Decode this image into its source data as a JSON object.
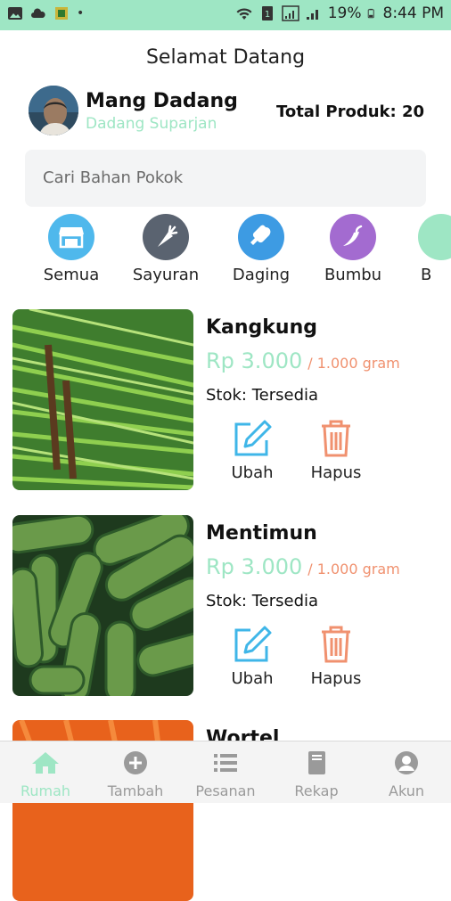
{
  "status_bar": {
    "battery": "19%",
    "time": "8:44 PM"
  },
  "header": {
    "title": "Selamat Datang"
  },
  "user": {
    "name": "Mang Dadang",
    "full_name": "Dadang Suparjan"
  },
  "total_products": "Total Produk: 20",
  "search": {
    "placeholder": "Cari Bahan Pokok"
  },
  "categories": [
    {
      "label": "Semua",
      "icon": "shop-icon",
      "color": "#4fb8ec"
    },
    {
      "label": "Sayuran",
      "icon": "carrot-icon",
      "color": "#5a6370"
    },
    {
      "label": "Daging",
      "icon": "meat-icon",
      "color": "#3d9be3"
    },
    {
      "label": "Bumbu",
      "icon": "chili-icon",
      "color": "#a36bd0"
    },
    {
      "label": "B",
      "icon": "category-icon",
      "color": "#9ee6c4"
    }
  ],
  "products": [
    {
      "name": "Kangkung",
      "price": "Rp 3.000",
      "unit": "/ 1.000 gram",
      "stock": "Stok: Tersedia",
      "edit_label": "Ubah",
      "delete_label": "Hapus"
    },
    {
      "name": "Mentimun",
      "price": "Rp 3.000",
      "unit": "/ 1.000 gram",
      "stock": "Stok: Tersedia",
      "edit_label": "Ubah",
      "delete_label": "Hapus"
    },
    {
      "name": "Wortel"
    }
  ],
  "bottom_nav": [
    {
      "label": "Rumah",
      "icon": "home-icon",
      "active": true
    },
    {
      "label": "Tambah",
      "icon": "add-circle-icon"
    },
    {
      "label": "Pesanan",
      "icon": "list-icon"
    },
    {
      "label": "Rekap",
      "icon": "book-icon"
    },
    {
      "label": "Akun",
      "icon": "account-icon"
    }
  ],
  "colors": {
    "accent": "#9ee6c4",
    "edit": "#3fb6e8",
    "delete": "#f0916f"
  }
}
